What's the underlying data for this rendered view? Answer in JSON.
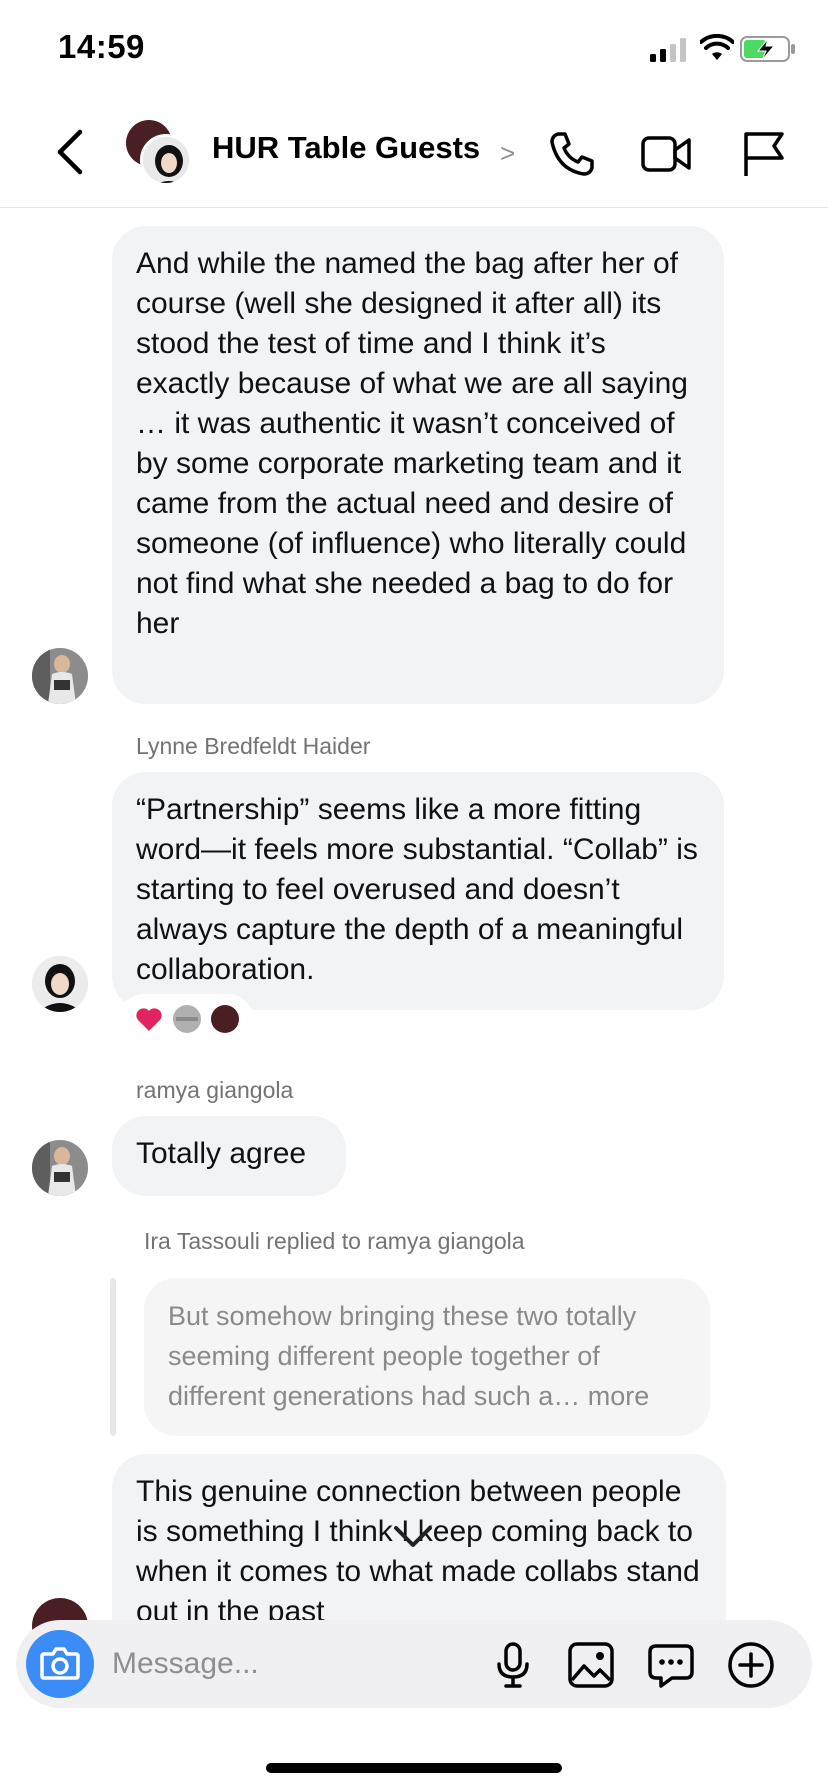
{
  "status": {
    "time": "14:59"
  },
  "header": {
    "title": "HUR Table Guests",
    "chevron": ">"
  },
  "messages": {
    "m1": "And while the named the bag after her of course (well she designed it after all) its stood the test of time and I think it’s exactly because of what we are all saying … it was authentic it wasn’t conceived of by some corporate marketing team and it came from the actual need and desire of someone (of influence) who literally could not find what she needed a bag to do for her",
    "sender2": "Lynne Bredfeldt Haider",
    "m2": "“Partnership” seems like a more fitting word—it feels more substantial. “Collab” is starting to feel overused and doesn’t always capture the depth of a meaningful collaboration.",
    "sender3": "ramya giangola",
    "m3": "Totally agree",
    "reply_label": "Ira Tassouli replied to ramya giangola",
    "reply_quote": "But somehow bringing these two totally seeming different people together of different generations had such a… more",
    "m4": "This genuine connection between people is something I think I keep coming back to when it comes to what made collabs stand out in the past"
  },
  "reactions": [
    "heart",
    "grey-avatar",
    "maroon-avatar"
  ],
  "composer": {
    "placeholder": "Message..."
  },
  "colors": {
    "accent": "#3b8cf6",
    "bubble": "#f2f3f5",
    "heart": "#e0245e",
    "maroon": "#4a1f24"
  }
}
